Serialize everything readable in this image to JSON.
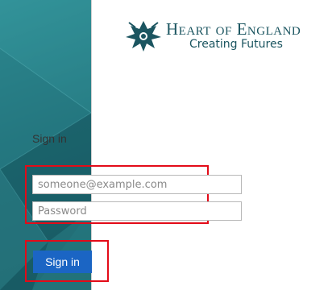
{
  "brand": {
    "name": "Heart of England",
    "tagline": "Creating Futures"
  },
  "signin": {
    "heading": "Sign in",
    "username_placeholder": "someone@example.com",
    "password_placeholder": "Password",
    "button_label": "Sign in"
  },
  "colors": {
    "panel": "#1f6f78",
    "button": "#1b65c4",
    "highlight": "#e30b18",
    "brand_text": "#1b5560"
  }
}
